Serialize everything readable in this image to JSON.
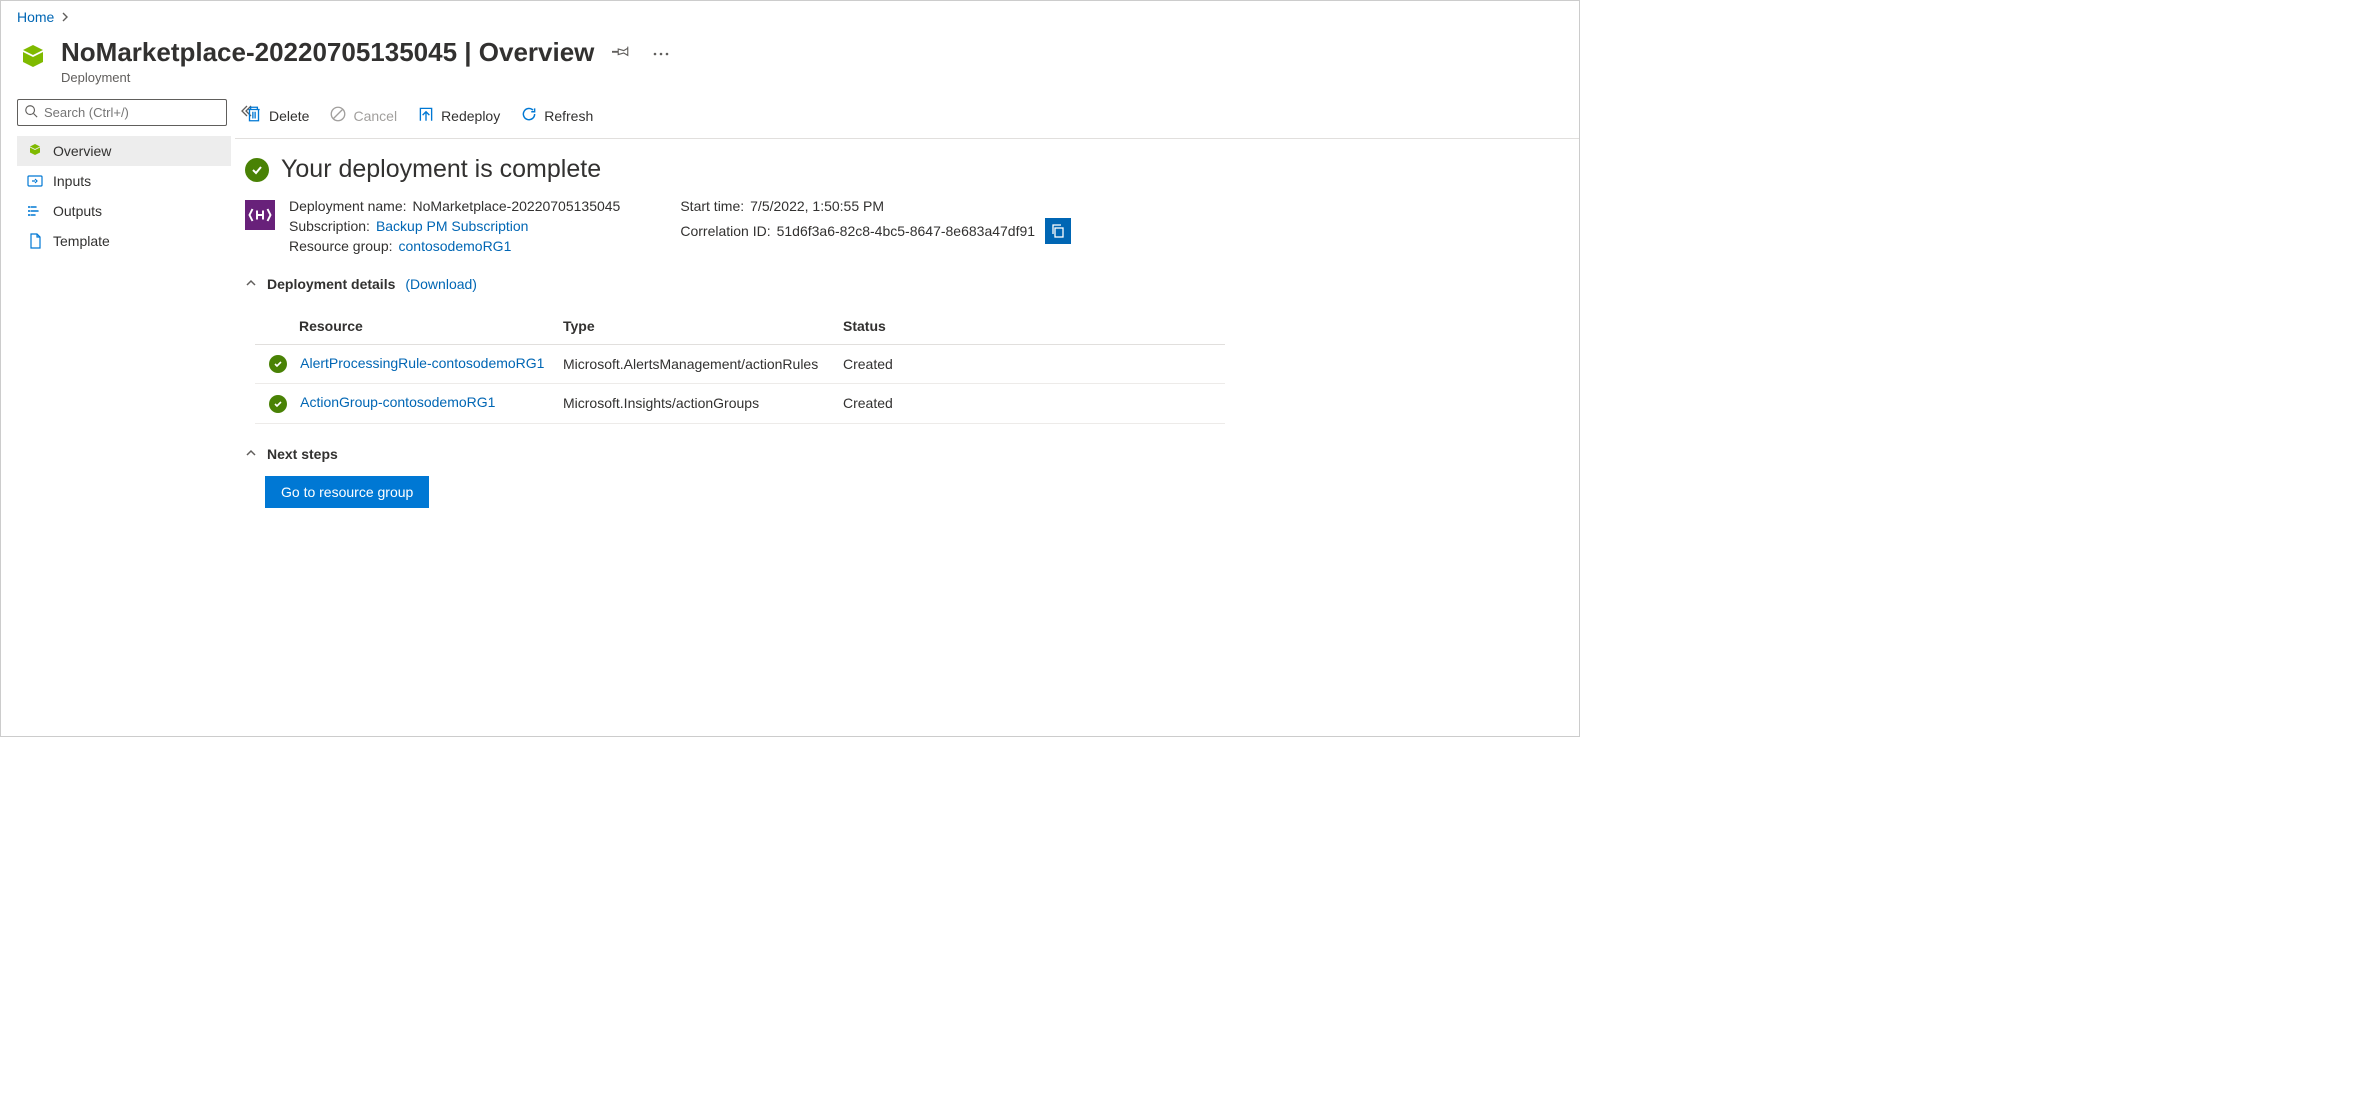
{
  "breadcrumb": {
    "home": "Home"
  },
  "header": {
    "title": "NoMarketplace-20220705135045 | Overview",
    "subtitle": "Deployment"
  },
  "sidebar": {
    "search_placeholder": "Search (Ctrl+/)",
    "items": [
      {
        "label": "Overview"
      },
      {
        "label": "Inputs"
      },
      {
        "label": "Outputs"
      },
      {
        "label": "Template"
      }
    ]
  },
  "toolbar": {
    "delete": "Delete",
    "cancel": "Cancel",
    "redeploy": "Redeploy",
    "refresh": "Refresh"
  },
  "status": {
    "message": "Your deployment is complete"
  },
  "meta": {
    "deployment_name_label": "Deployment name:",
    "deployment_name": "NoMarketplace-20220705135045",
    "subscription_label": "Subscription:",
    "subscription": "Backup PM Subscription",
    "resource_group_label": "Resource group:",
    "resource_group": "contosodemoRG1",
    "start_time_label": "Start time:",
    "start_time": "7/5/2022, 1:50:55 PM",
    "correlation_label": "Correlation ID:",
    "correlation_id": "51d6f3a6-82c8-4bc5-8647-8e683a47df91"
  },
  "details": {
    "title": "Deployment details",
    "download": "(Download)",
    "columns": {
      "resource": "Resource",
      "type": "Type",
      "status": "Status"
    },
    "rows": [
      {
        "resource": "AlertProcessingRule-contosodemoRG1",
        "type": "Microsoft.AlertsManagement/actionRules",
        "status": "Created"
      },
      {
        "resource": "ActionGroup-contosodemoRG1",
        "type": "Microsoft.Insights/actionGroups",
        "status": "Created"
      }
    ]
  },
  "nextsteps": {
    "title": "Next steps",
    "button": "Go to resource group"
  }
}
